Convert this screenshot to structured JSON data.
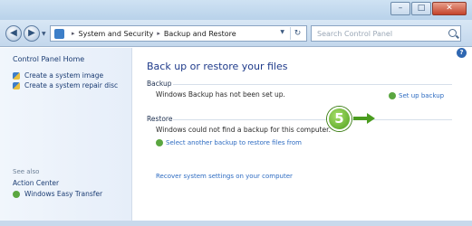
{
  "window": {
    "controls": {
      "minimize": "–",
      "maximize": "□",
      "close": "✕"
    }
  },
  "address_bar": {
    "icon": "control-panel-icon",
    "crumbs": [
      "System and Security",
      "Backup and Restore"
    ],
    "separator": "▸"
  },
  "search": {
    "placeholder": "Search Control Panel"
  },
  "left_pane": {
    "home_link": "Control Panel Home",
    "tasks": [
      {
        "label": "Create a system image",
        "icon": "shield-icon"
      },
      {
        "label": "Create a system repair disc",
        "icon": "shield-icon"
      }
    ],
    "see_also_label": "See also",
    "see_also": [
      {
        "label": "Action Center",
        "icon": ""
      },
      {
        "label": "Windows Easy Transfer",
        "icon": "transfer-icon"
      }
    ]
  },
  "main": {
    "heading": "Back up or restore your files",
    "backup_section": {
      "label": "Backup",
      "status_text": "Windows Backup has not been set up.",
      "setup_link": "Set up backup"
    },
    "restore_section": {
      "label": "Restore",
      "status_text": "Windows could not find a backup for this computer.",
      "select_link": "Select another backup to restore files from",
      "recover_link": "Recover system settings on your computer"
    }
  },
  "callout": {
    "number": "5",
    "color": "#4e9f1e"
  },
  "colors": {
    "link": "#2d6bc1",
    "heading": "#1e3a8a",
    "titlebar": "#cfe2f3"
  }
}
